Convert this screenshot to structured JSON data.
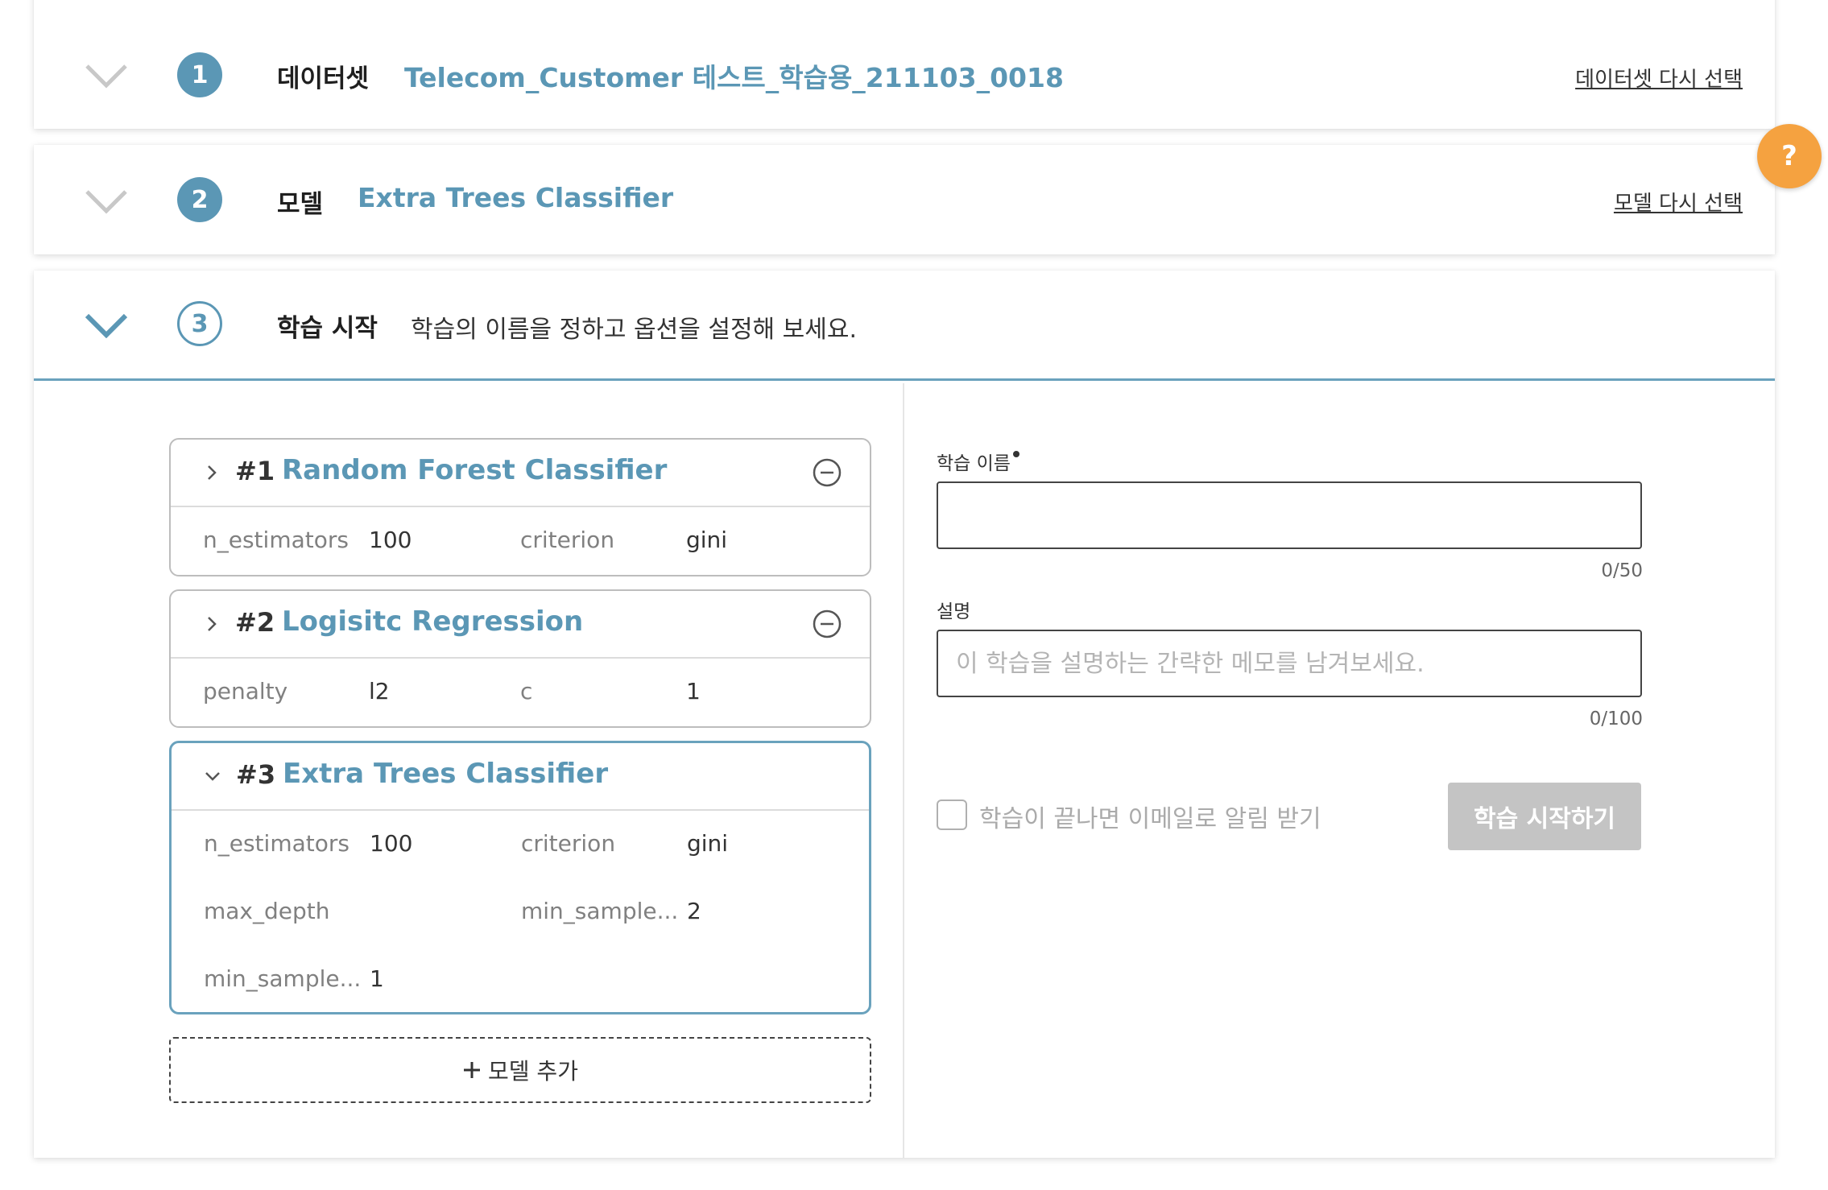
{
  "steps": [
    {
      "number": "1",
      "title": "데이터셋",
      "value": "Telecom_Customer 테스트_학습용_211103_0018",
      "reselect": "데이터셋 다시 선택"
    },
    {
      "number": "2",
      "title": "모델",
      "value": "Extra Trees Classifier",
      "reselect": "모델 다시 선택"
    },
    {
      "number": "3",
      "title": "학습 시작",
      "description": "학습의 이름을 정하고 옵션을 설정해 보세요."
    }
  ],
  "help_label": "?",
  "models": [
    {
      "num": "#1",
      "name": "Random Forest Classifier",
      "params": [
        [
          "n_estimators",
          "100",
          "criterion",
          "gini"
        ]
      ]
    },
    {
      "num": "#2",
      "name": "Logisitc Regression",
      "params": [
        [
          "penalty",
          "l2",
          "c",
          "1"
        ]
      ]
    },
    {
      "num": "#3",
      "name": "Extra Trees Classifier",
      "params": [
        [
          "n_estimators",
          "100",
          "criterion",
          "gini"
        ],
        [
          "max_depth",
          "",
          "min_sample...",
          "2"
        ],
        [
          "min_sample...",
          "1",
          "",
          ""
        ]
      ]
    }
  ],
  "add_model_label": "모델 추가",
  "form": {
    "name_label": "학습 이름",
    "name_value": "",
    "name_counter": "0/50",
    "desc_label": "설명",
    "desc_placeholder": "이 학습을 설명하는 간략한 메모를 남겨보세요.",
    "desc_counter": "0/100",
    "email_notify_label": "학습이 끝나면 이메일로 알림 받기",
    "start_button": "학습 시작하기"
  },
  "colors": {
    "accent": "#5b97b5",
    "help": "#f5a240",
    "disabled": "#c4c4c4"
  }
}
